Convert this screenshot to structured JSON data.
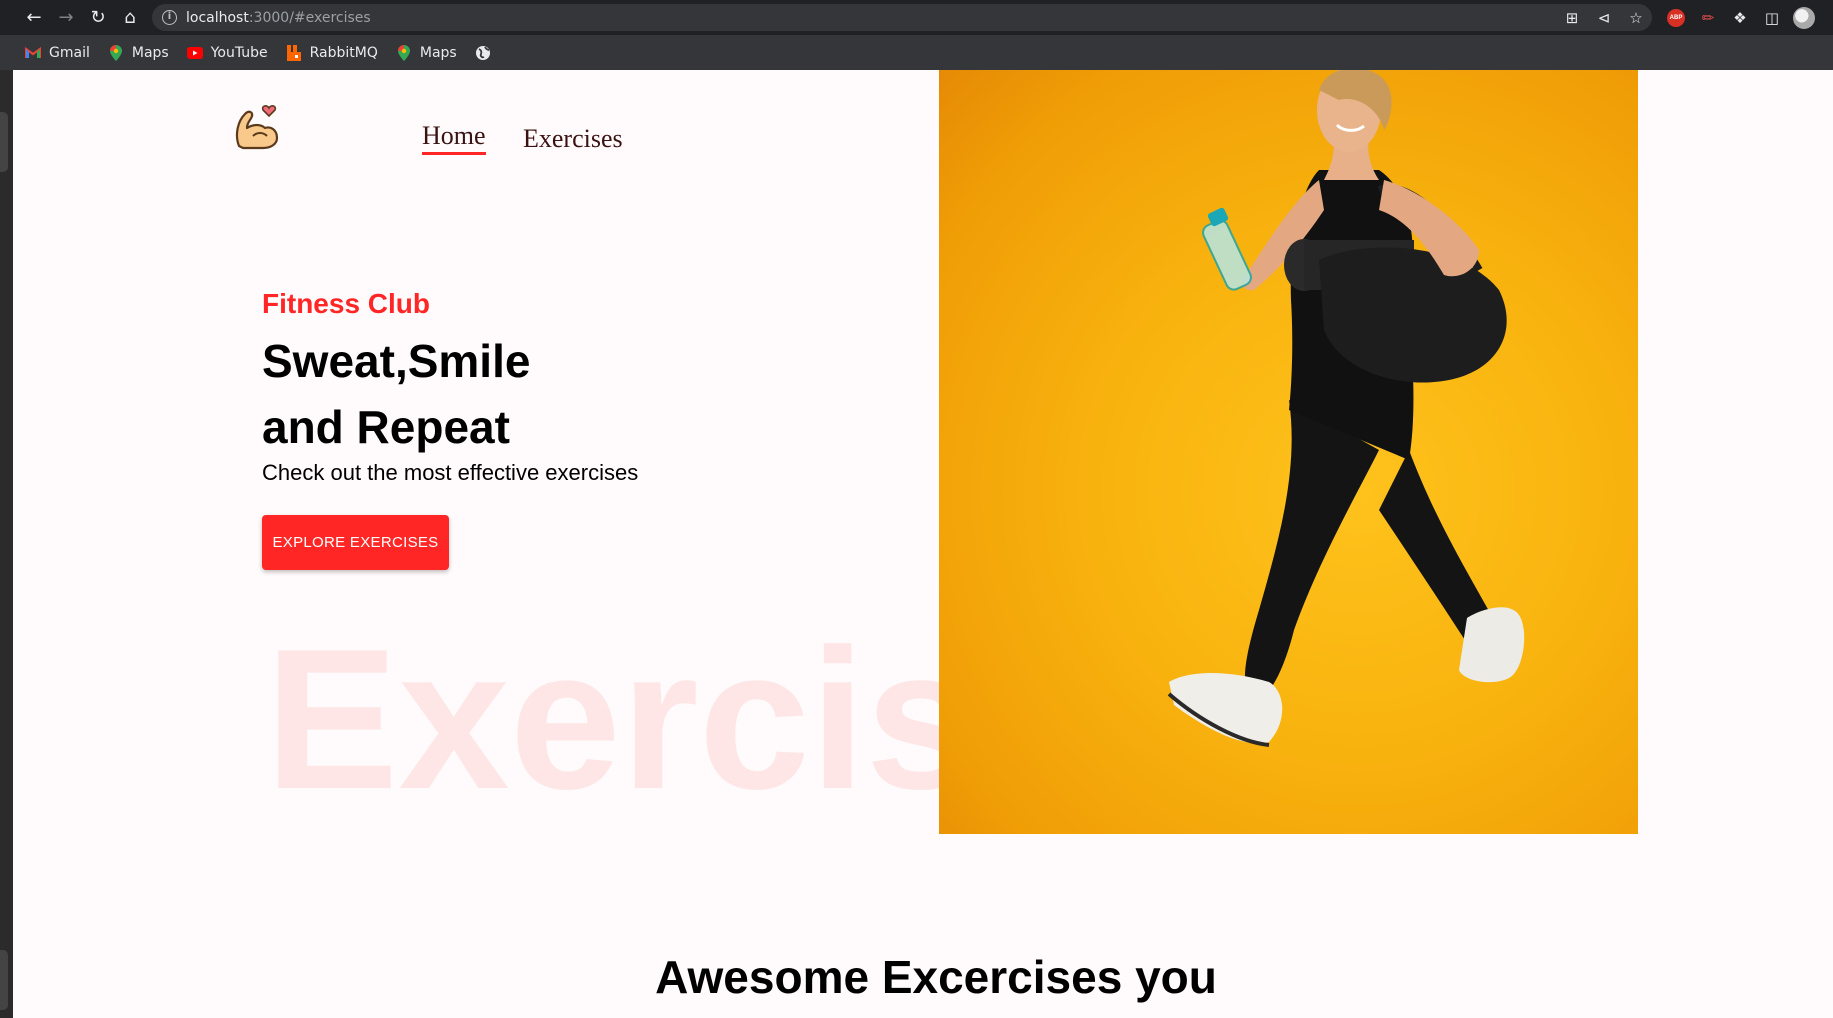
{
  "browser": {
    "url_host": "localhost",
    "url_rest": ":3000/#exercises",
    "bookmarks": [
      {
        "label": "Gmail",
        "icon": "gmail-icon"
      },
      {
        "label": "Maps",
        "icon": "maps-pin-icon"
      },
      {
        "label": "YouTube",
        "icon": "youtube-icon"
      },
      {
        "label": "RabbitMQ",
        "icon": "rabbitmq-icon"
      },
      {
        "label": "Maps",
        "icon": "maps-pin-icon"
      }
    ],
    "extension_abp_label": "ABP"
  },
  "nav": {
    "home": "Home",
    "exercises": "Exercises"
  },
  "hero": {
    "subtitle": "Fitness Club",
    "headline_line1": "Sweat,Smile",
    "headline_line2": "and Repeat",
    "tagline": "Check out the most effective exercises",
    "cta": "EXPLORE EXERCISES",
    "watermark": "Exercise"
  },
  "section": {
    "title": "Awesome Excercises you"
  },
  "colors": {
    "accent": "#ff2625",
    "page_bg": "#fffafb",
    "hero_bg": "#f8b20e"
  }
}
